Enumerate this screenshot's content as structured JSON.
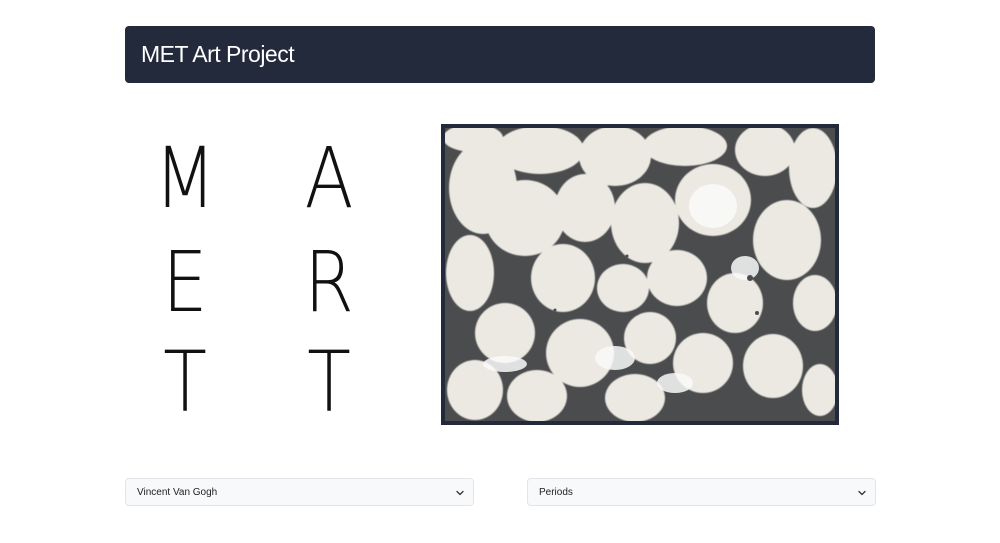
{
  "header": {
    "title": "MET Art Project",
    "background": "#222a3b"
  },
  "logo_letters": {
    "column_1": [
      "M",
      "E",
      "T"
    ],
    "column_2": [
      "A",
      "R",
      "T"
    ]
  },
  "artwork": {
    "frame_color": "#222a3b",
    "description_icon": "marbled-paper-artwork"
  },
  "filters": {
    "artist_select": {
      "selected": "Vincent Van Gogh",
      "icon": "chevron-down-icon"
    },
    "period_select": {
      "selected": "Periods",
      "icon": "chevron-down-icon"
    }
  }
}
